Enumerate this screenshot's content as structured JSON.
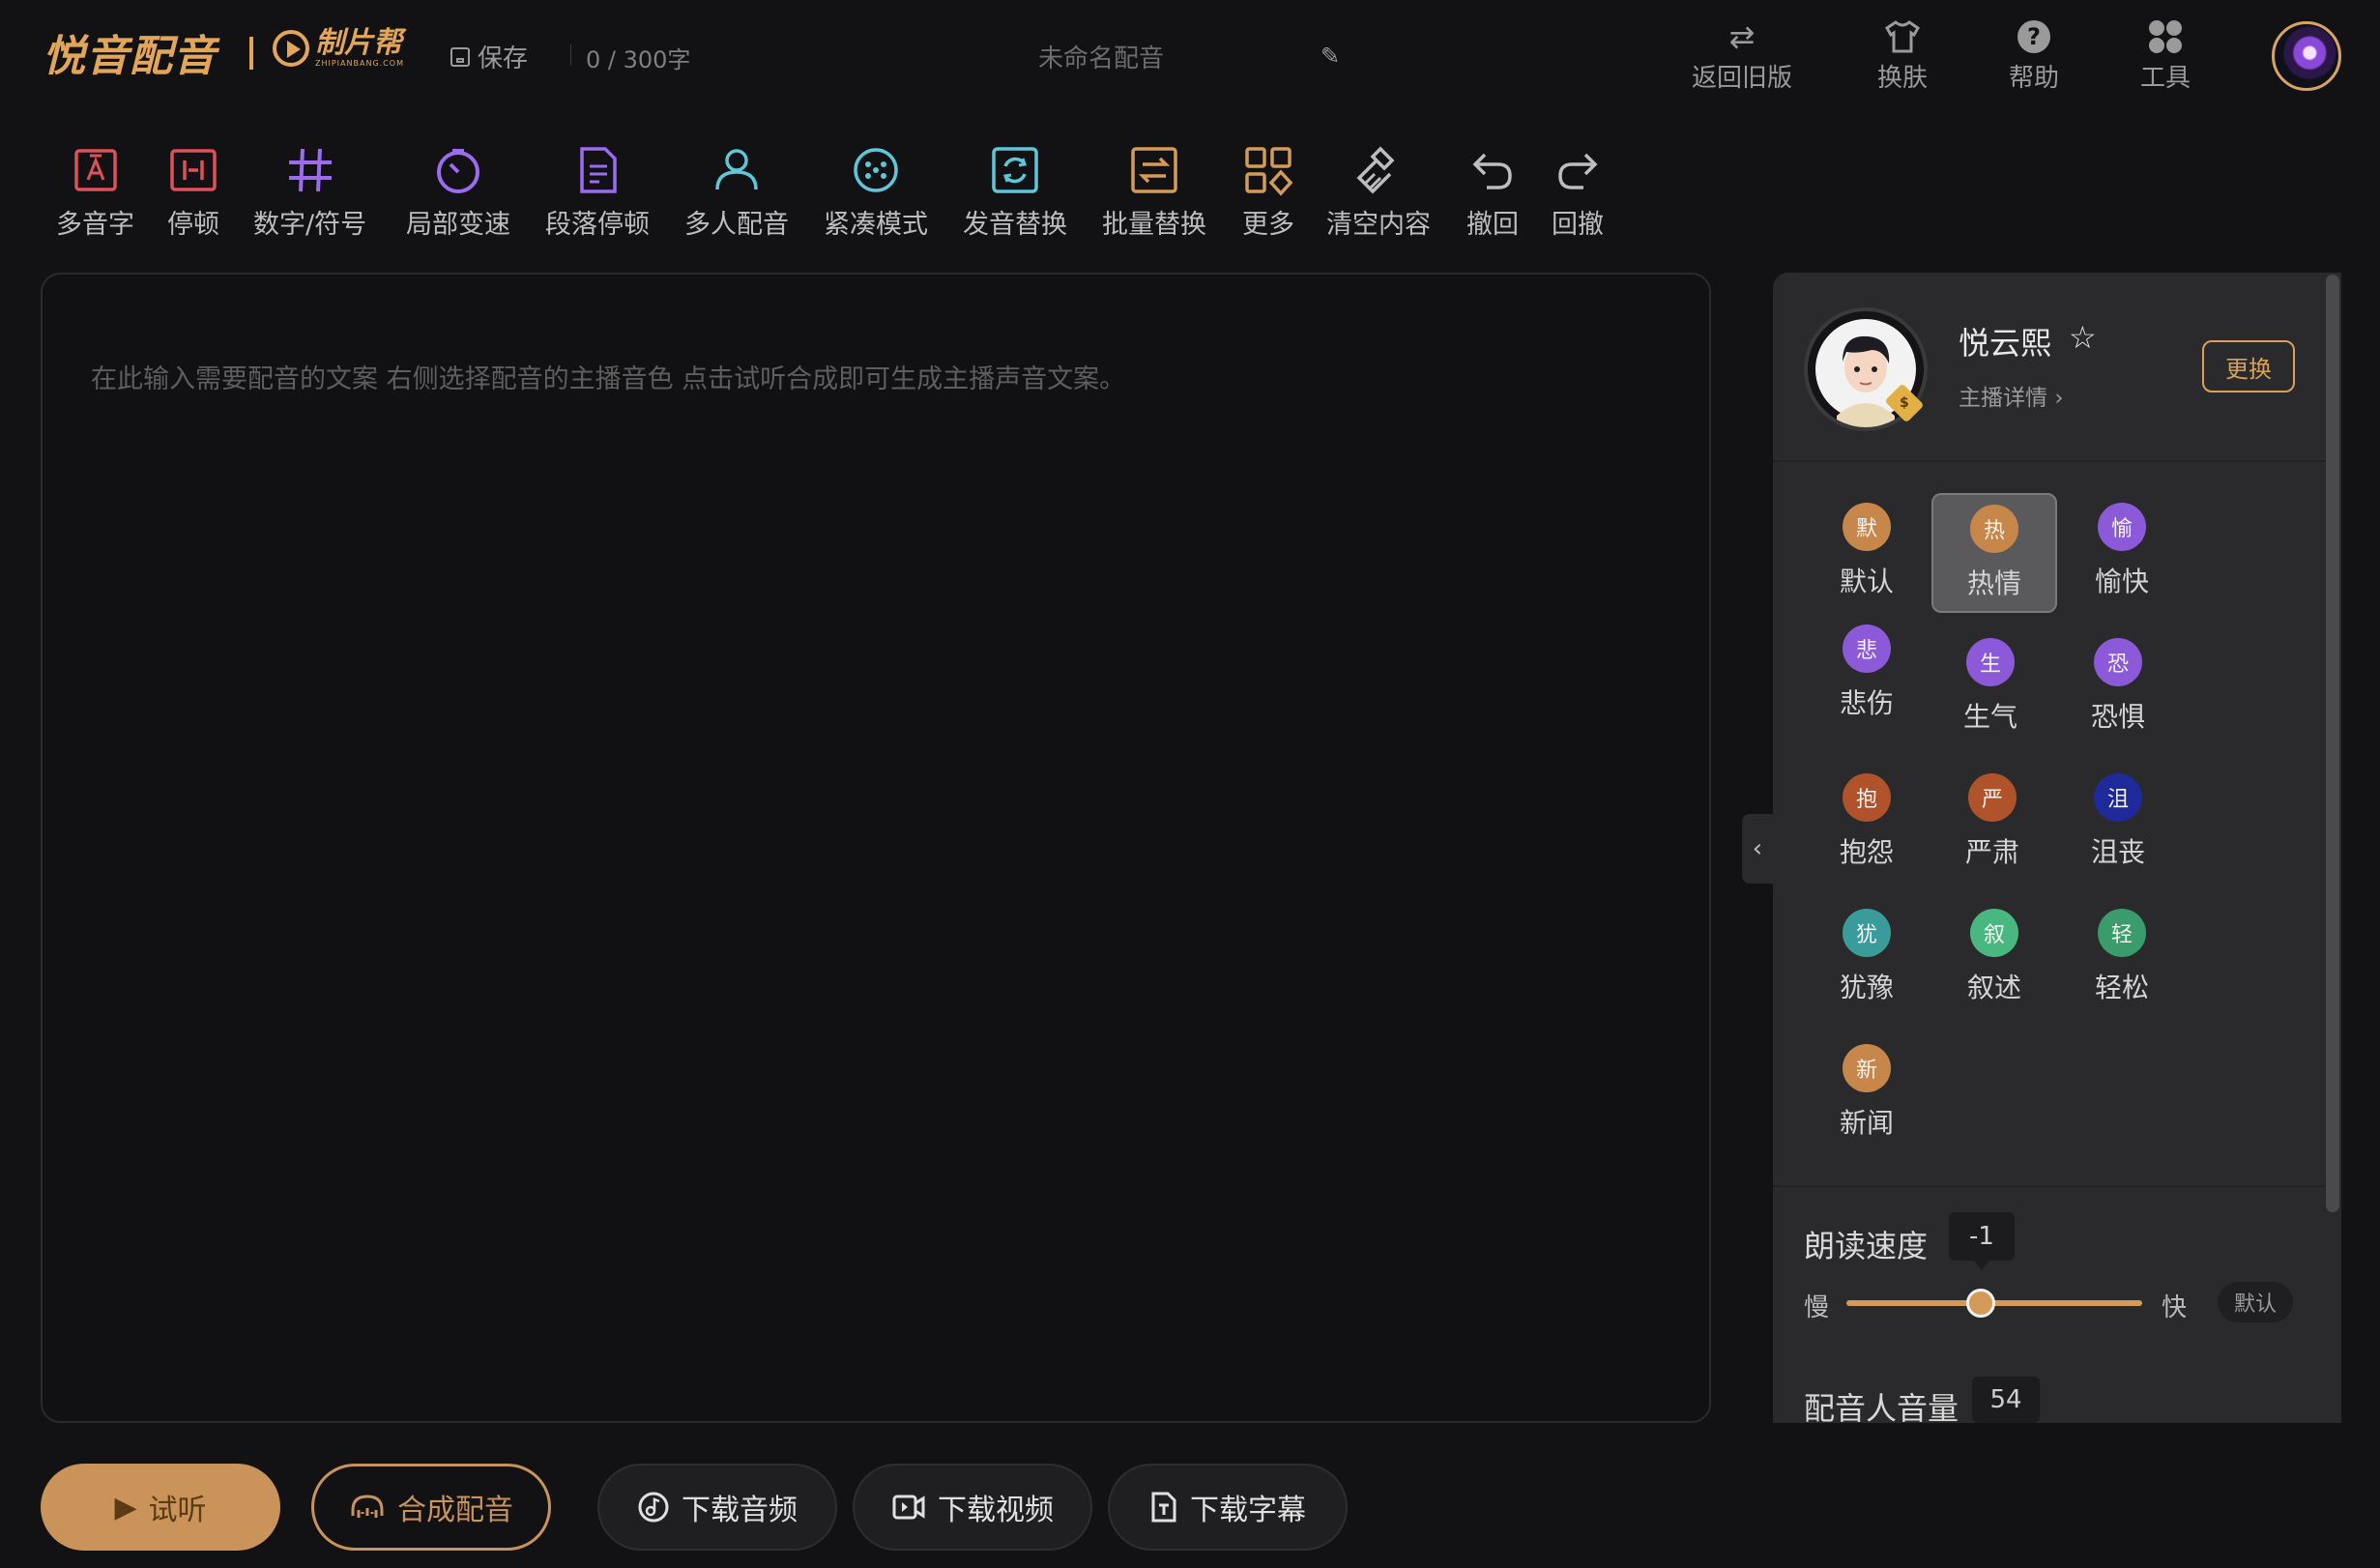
{
  "header": {
    "logo": "悦音配音",
    "sub_logo": "制片帮",
    "sub_logo_small": "ZHIPIANBANG.COM",
    "save_label": "保存",
    "char_count": "0 / 300字",
    "project_title": "未命名配音",
    "actions": [
      {
        "label": "返回旧版",
        "icon": "swap-icon"
      },
      {
        "label": "换肤",
        "icon": "shirt-icon"
      },
      {
        "label": "帮助",
        "icon": "help-icon"
      },
      {
        "label": "工具",
        "icon": "tools-icon"
      }
    ]
  },
  "toolbar": [
    {
      "label": "多音字",
      "icon": "polyphone-icon",
      "color": "#e0505a"
    },
    {
      "label": "停顿",
      "icon": "pause-icon",
      "color": "#e0505a"
    },
    {
      "label": "数字/符号",
      "icon": "hash-icon",
      "color": "#9b6cf0"
    },
    {
      "label": "局部变速",
      "icon": "speed-icon",
      "color": "#9b6cf0"
    },
    {
      "label": "段落停顿",
      "icon": "paragraph-pause-icon",
      "color": "#9b6cf0"
    },
    {
      "label": "多人配音",
      "icon": "multi-voice-icon",
      "color": "#5fc6d8"
    },
    {
      "label": "紧凑模式",
      "icon": "compact-icon",
      "color": "#5fc6d8"
    },
    {
      "label": "发音替换",
      "icon": "pronounce-replace-icon",
      "color": "#5fc6d8"
    },
    {
      "label": "批量替换",
      "icon": "batch-replace-icon",
      "color": "#d39b57"
    },
    {
      "label": "更多",
      "icon": "more-icon",
      "color": "#d39b57"
    },
    {
      "label": "清空内容",
      "icon": "clear-icon",
      "color": "#bdbdbd"
    },
    {
      "label": "撤回",
      "icon": "undo-icon",
      "color": "#bdbdbd"
    },
    {
      "label": "回撤",
      "icon": "redo-icon",
      "color": "#bdbdbd"
    }
  ],
  "editor": {
    "placeholder": "在此输入需要配音的文案 右侧选择配音的主播音色 点击试听合成即可生成主播声音文案。"
  },
  "panel": {
    "anchor_name": "悦云熙",
    "anchor_detail": "主播详情",
    "change_label": "更换",
    "badge": "$",
    "emotions": [
      {
        "char": "默",
        "label": "默认",
        "color": "#c8874a",
        "selected": false
      },
      {
        "char": "热",
        "label": "热情",
        "color": "#c8874a",
        "selected": true
      },
      {
        "char": "愉",
        "label": "愉快",
        "color": "#8c5ad8",
        "selected": false
      },
      {
        "char": "悲",
        "label": "悲伤",
        "color": "#8c5ad8",
        "selected": false
      },
      {
        "char": "生",
        "label": "生气",
        "color": "#8c5ad8",
        "selected": false
      },
      {
        "char": "恐",
        "label": "恐惧",
        "color": "#8c5ad8",
        "selected": false
      },
      {
        "char": "抱",
        "label": "抱怨",
        "color": "#b0532b",
        "selected": false
      },
      {
        "char": "严",
        "label": "严肃",
        "color": "#b0532b",
        "selected": false
      },
      {
        "char": "沮",
        "label": "沮丧",
        "color": "#1e2a9a",
        "selected": false
      },
      {
        "char": "犹",
        "label": "犹豫",
        "color": "#3a9c9a",
        "selected": false
      },
      {
        "char": "叙",
        "label": "叙述",
        "color": "#48b880",
        "selected": false
      },
      {
        "char": "轻",
        "label": "轻松",
        "color": "#3a9c6a",
        "selected": false
      },
      {
        "char": "新",
        "label": "新闻",
        "color": "#c8874a",
        "selected": false
      }
    ],
    "speed": {
      "label": "朗读速度",
      "value": "-1",
      "slow_label": "慢",
      "fast_label": "快",
      "default_label": "默认",
      "position_fraction": 0.45
    },
    "volume": {
      "label": "配音人音量",
      "value": "54"
    }
  },
  "bottom": {
    "preview": "试听",
    "synthesize": "合成配音",
    "download_audio": "下载音频",
    "download_video": "下载视频",
    "download_subtitle": "下载字幕"
  },
  "colors": {
    "accent": "#d39b57",
    "background": "#121214",
    "panel": "#2a2a2c"
  }
}
